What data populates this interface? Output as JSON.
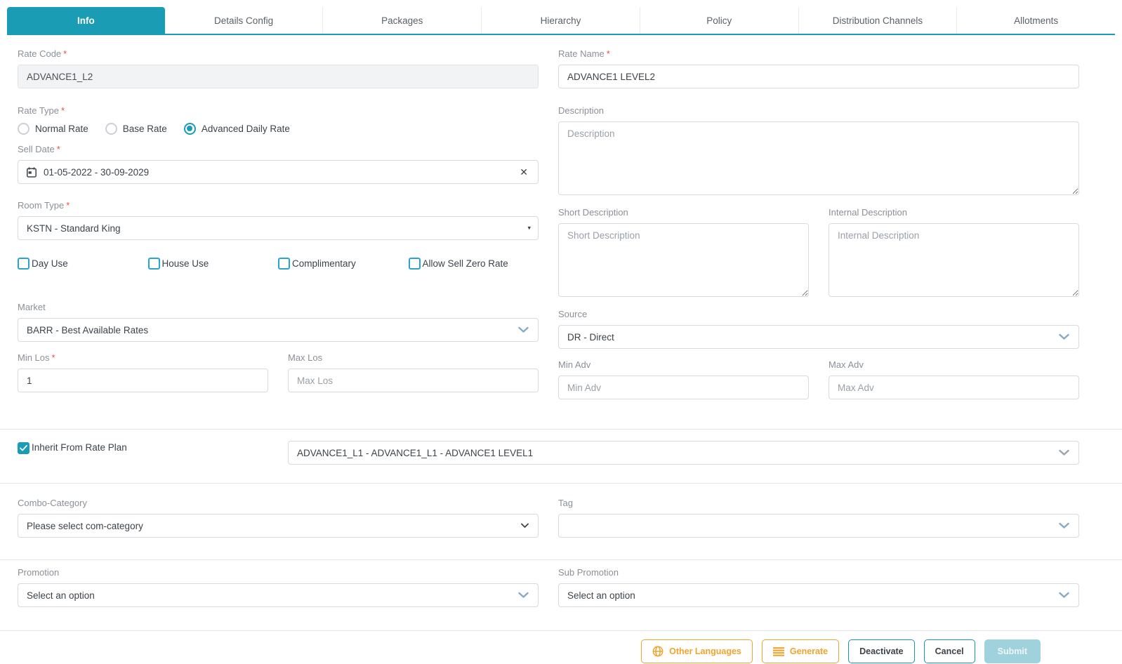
{
  "tabs": [
    {
      "label": "Info",
      "active": true
    },
    {
      "label": "Details Config",
      "active": false
    },
    {
      "label": "Packages",
      "active": false
    },
    {
      "label": "Hierarchy",
      "active": false
    },
    {
      "label": "Policy",
      "active": false
    },
    {
      "label": "Distribution Channels",
      "active": false
    },
    {
      "label": "Allotments",
      "active": false
    }
  ],
  "shared": {
    "required_marker": "*",
    "clear_icon": "✕"
  },
  "fields": {
    "rate_code": {
      "label": "Rate Code",
      "value": "ADVANCE1_L2",
      "disabled": true
    },
    "rate_name": {
      "label": "Rate Name",
      "value": "ADVANCE1 LEVEL2"
    },
    "rate_type": {
      "label": "Rate Type",
      "options": [
        {
          "label": "Normal Rate",
          "selected": false
        },
        {
          "label": "Base Rate",
          "selected": false
        },
        {
          "label": "Advanced Daily Rate",
          "selected": true
        }
      ]
    },
    "sell_date": {
      "label": "Sell Date",
      "value": "01-05-2022 - 30-09-2029"
    },
    "room_type": {
      "label": "Room Type",
      "value": "KSTN - Standard King"
    },
    "description": {
      "label": "Description",
      "placeholder": "Description"
    },
    "short_description": {
      "label": "Short Description",
      "placeholder": "Short Description"
    },
    "internal_description": {
      "label": "Internal Description",
      "placeholder": "Internal Description"
    },
    "checkboxes": [
      {
        "label": "Day Use",
        "checked": false
      },
      {
        "label": "House Use",
        "checked": false
      },
      {
        "label": "Complimentary",
        "checked": false
      },
      {
        "label": "Allow Sell Zero Rate",
        "checked": false
      }
    ],
    "market": {
      "label": "Market",
      "value": "BARR - Best Available Rates"
    },
    "source": {
      "label": "Source",
      "value": "DR - Direct"
    },
    "min_los": {
      "label": "Min Los",
      "value": "1"
    },
    "max_los": {
      "label": "Max Los",
      "placeholder": "Max Los"
    },
    "min_adv": {
      "label": "Min Adv",
      "placeholder": "Min Adv"
    },
    "max_adv": {
      "label": "Max Adv",
      "placeholder": "Max Adv"
    },
    "inherit_from_rate_plan": {
      "label": "Inherit From Rate Plan",
      "checked": true,
      "value": "ADVANCE1_L1 - ADVANCE1_L1 - ADVANCE1 LEVEL1"
    },
    "combo_category": {
      "label": "Combo-Category",
      "value": "Please select com-category"
    },
    "tag": {
      "label": "Tag",
      "value": ""
    },
    "promotion": {
      "label": "Promotion",
      "value": "Select an option"
    },
    "sub_promotion": {
      "label": "Sub Promotion",
      "value": "Select an option"
    }
  },
  "footer": {
    "other_languages_label": "Other Languages",
    "generate_label": "Generate",
    "deactivate_label": "Deactivate",
    "cancel_label": "Cancel",
    "submit_label": "Submit"
  },
  "colors": {
    "accent_teal": "#1a9cb4",
    "accent_orange": "#f0a32e",
    "checkbox_blue": "#2ba4cb"
  }
}
